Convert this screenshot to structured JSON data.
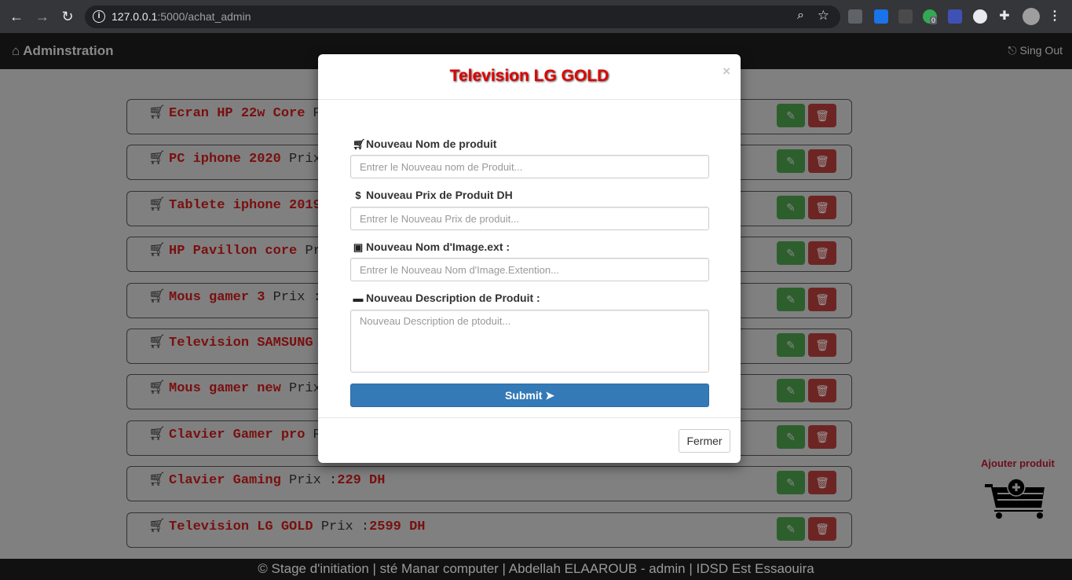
{
  "browser": {
    "url_host": "127.0.0.1",
    "url_path": ":5000/achat_admin",
    "ext_badge": "0"
  },
  "navbar": {
    "brand": "Adminstration",
    "signout": "Sing Out"
  },
  "products": [
    {
      "name": "Ecran HP 22w Core",
      "price_prefix": "Prix :",
      "price": ""
    },
    {
      "name": "PC iphone 2020",
      "price_prefix": "Prix",
      "price": ""
    },
    {
      "name": "Tablete iphone 2019",
      "price_prefix": "",
      "price": ""
    },
    {
      "name": "HP Pavillon core",
      "price_prefix": "Pr",
      "price": ""
    },
    {
      "name": "Mous gamer 3",
      "price_prefix": "Prix :",
      "price": ""
    },
    {
      "name": "Television SAMSUNG",
      "price_prefix": "",
      "price": ""
    },
    {
      "name": "Mous gamer new",
      "price_prefix": "Prix",
      "price": ""
    },
    {
      "name": "Clavier Gamer pro",
      "price_prefix": "P",
      "price": ""
    },
    {
      "name": "Clavier Gaming",
      "price_prefix": "Prix :",
      "price": "229 DH"
    },
    {
      "name": "Television LG GOLD",
      "price_prefix": "Prix :",
      "price": "2599 DH"
    }
  ],
  "add_product_label": "Ajouter produit",
  "footer": "© Stage d'initiation | sté Manar computer | Abdellah ELAAROUB - admin | IDSD Est Essaouira",
  "modal": {
    "title": "Television LG GOLD",
    "close": "×",
    "name_label": "Nouveau Nom de produit",
    "name_placeholder": "Entrer le Nouveau nom de Produit...",
    "price_label": "Nouveau Prix de Produit DH",
    "price_placeholder": "Entrer le Nouveau Prix de produit...",
    "image_label": "Nouveau Nom d'Image.ext :",
    "image_placeholder": "Entrer le Nouveau Nom d'Image.Extention...",
    "desc_label": "Nouveau Description de Produit :",
    "desc_placeholder": "Nouveau Description de ptoduit...",
    "submit": "Submit",
    "fermer": "Fermer"
  },
  "colors": {
    "title_red": "#e00000",
    "product_red": "#7a0f0f",
    "primary_blue": "#337ab7",
    "edit_green": "#2d5f2d",
    "delete_red": "#6d2524"
  }
}
